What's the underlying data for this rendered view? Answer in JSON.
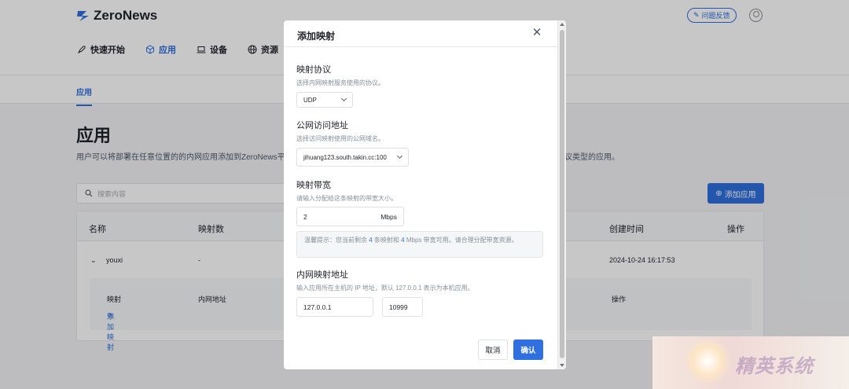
{
  "app": {
    "name": "ZeroNews",
    "feedback_label": "问题反馈"
  },
  "nav": {
    "items": [
      {
        "label": "快速开始",
        "icon": "rocket-icon"
      },
      {
        "label": "应用",
        "icon": "cube-icon"
      },
      {
        "label": "设备",
        "icon": "laptop-icon"
      },
      {
        "label": "资源",
        "icon": "globe-icon"
      }
    ]
  },
  "subnav": {
    "tab": "应用"
  },
  "page": {
    "title": "应用",
    "description": "用户可以将部署在任意位置的的内网应用添加到ZeroNews平",
    "description_tail": "议类型的应用。",
    "search_placeholder": "搜索内容",
    "add_button": "添加应用"
  },
  "table": {
    "headers": {
      "name": "名称",
      "count": "映射数",
      "created": "创建时间",
      "ops": "操作"
    },
    "row": {
      "name": "youxi",
      "count": "-",
      "created": "2024-10-24 16:17:53"
    },
    "sub": {
      "col1": "映射",
      "col2": "内网地址",
      "col3": "操作",
      "add_mapping": "添加映射"
    }
  },
  "modal": {
    "title": "添加映射",
    "protocol": {
      "label": "映射协议",
      "help": "选择内网映射服务使用的协议。",
      "value": "UDP"
    },
    "domain": {
      "label": "公网访问地址",
      "help": "选择访问映射使用的公网域名。",
      "value": "jihuang123.south.takin.cc:100"
    },
    "bandwidth": {
      "label": "映射带宽",
      "help": "请输入分配给这条映射的带宽大小。",
      "value": "2",
      "unit": "Mbps"
    },
    "tip": {
      "prefix": "温馨提示：您当前剩余",
      "mappings": "4",
      "middle": "条映射和",
      "bandwidth": "4",
      "suffix": "Mbps 带宽可用。请合理分配带宽资源。"
    },
    "address": {
      "label": "内网映射地址",
      "help": "输入应用所在主机的 IP 地址，默认 127.0.0.1 表示为本机应用。",
      "ip": "127.0.0.1",
      "port": "10999"
    },
    "cancel_label": "取消",
    "ok_label": "确认"
  },
  "watermark": {
    "text": "精英系统"
  }
}
